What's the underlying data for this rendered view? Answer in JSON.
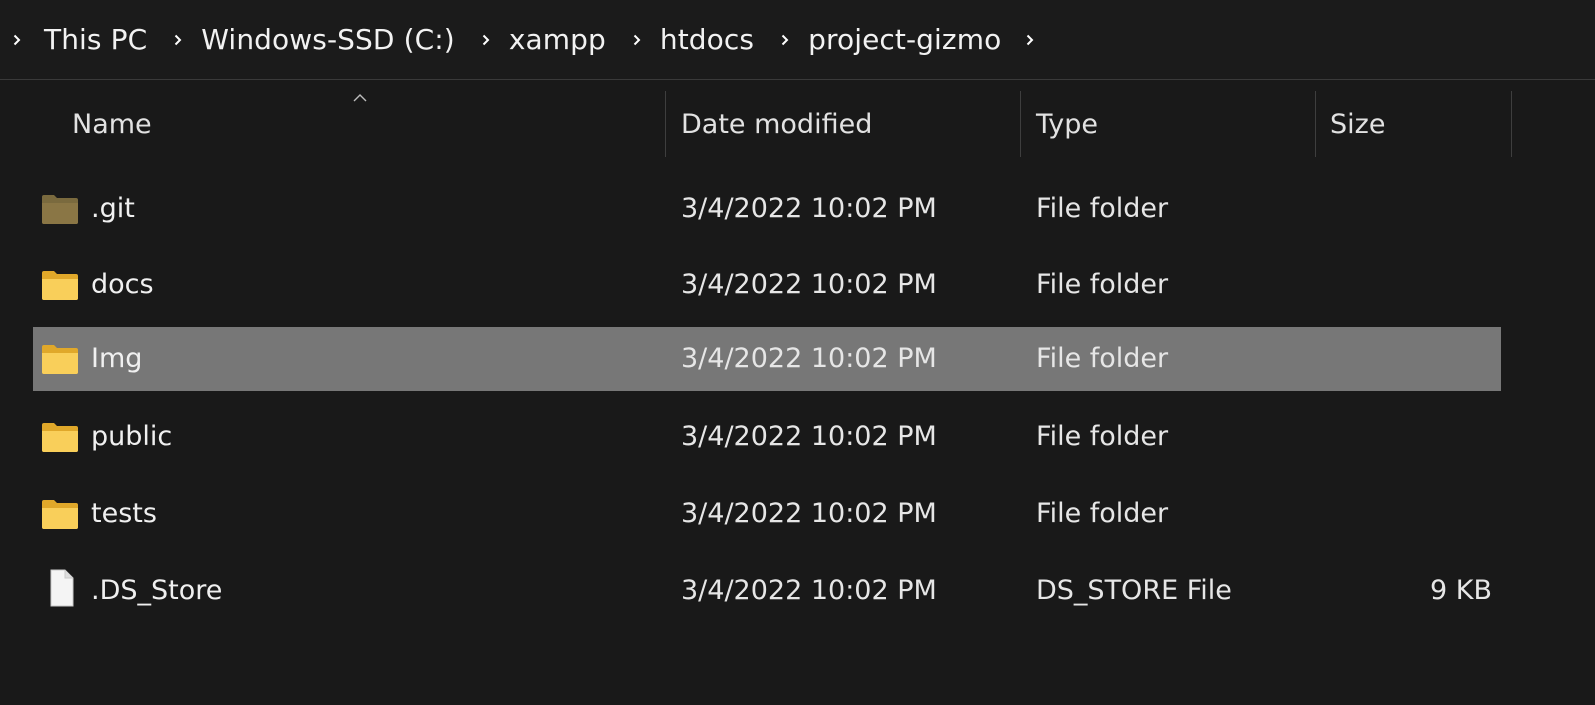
{
  "breadcrumb": {
    "items": [
      "This PC",
      "Windows-SSD (C:)",
      "xampp",
      "htdocs",
      "project-gizmo"
    ]
  },
  "columns": {
    "name": "Name",
    "date": "Date modified",
    "type": "Type",
    "size": "Size",
    "sorted_by": "Name",
    "sort_direction": "ascending"
  },
  "files": [
    {
      "name": ".git",
      "date": "3/4/2022 10:02 PM",
      "type": "File folder",
      "size": "",
      "icon": "hidden-folder-icon",
      "selected": false
    },
    {
      "name": "docs",
      "date": "3/4/2022 10:02 PM",
      "type": "File folder",
      "size": "",
      "icon": "folder-icon",
      "selected": false
    },
    {
      "name": "Img",
      "date": "3/4/2022 10:02 PM",
      "type": "File folder",
      "size": "",
      "icon": "folder-icon",
      "selected": true
    },
    {
      "name": "public",
      "date": "3/4/2022 10:02 PM",
      "type": "File folder",
      "size": "",
      "icon": "folder-icon",
      "selected": false
    },
    {
      "name": "tests",
      "date": "3/4/2022 10:02 PM",
      "type": "File folder",
      "size": "",
      "icon": "folder-icon",
      "selected": false
    },
    {
      "name": ".DS_Store",
      "date": "3/4/2022 10:02 PM",
      "type": "DS_STORE File",
      "size": "9 KB",
      "icon": "file-icon",
      "selected": false
    }
  ],
  "colors": {
    "background": "#191919",
    "selection": "#777777",
    "folder": "#f4c54a",
    "hidden_folder": "#8a7645"
  }
}
